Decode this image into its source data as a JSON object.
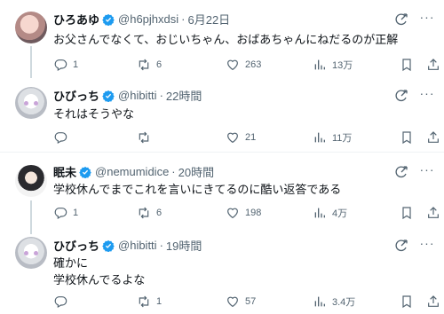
{
  "tweets": [
    {
      "name": "ひろあゆ",
      "handle": "@h6pjhxdsi",
      "time": "6月22日",
      "lines": [
        "お父さんでなくて、おじいちゃん、おばあちゃんにねだるのが正解"
      ],
      "replies": "1",
      "retweets": "6",
      "likes": "263",
      "views": "13万"
    },
    {
      "name": "ひびっち",
      "handle": "@hibitti",
      "time": "22時間",
      "lines": [
        "それはそうやな"
      ],
      "replies": "",
      "retweets": "",
      "likes": "21",
      "views": "11万"
    },
    {
      "name": "眠未",
      "handle": "@nemumidice",
      "time": "20時間",
      "lines": [
        "学校休んでまでこれを言いにきてるのに酷い返答である"
      ],
      "replies": "1",
      "retweets": "6",
      "likes": "198",
      "views": "4万"
    },
    {
      "name": "ひびっち",
      "handle": "@hibitti",
      "time": "19時間",
      "lines": [
        "確かに",
        "学校休んでるよな"
      ],
      "replies": "",
      "retweets": "1",
      "likes": "57",
      "views": "3.4万"
    }
  ],
  "separator": "·",
  "icons": {
    "verified": "verified-badge-icon",
    "grok": "grok-icon",
    "more": "more-icon",
    "reply": "reply-icon",
    "retweet": "retweet-icon",
    "like": "heart-icon",
    "views": "views-icon",
    "bookmark": "bookmark-icon",
    "share": "share-icon"
  },
  "colors": {
    "verified": "#1d9bf0",
    "text_secondary": "#536471",
    "thread_line": "#cfd9de"
  }
}
